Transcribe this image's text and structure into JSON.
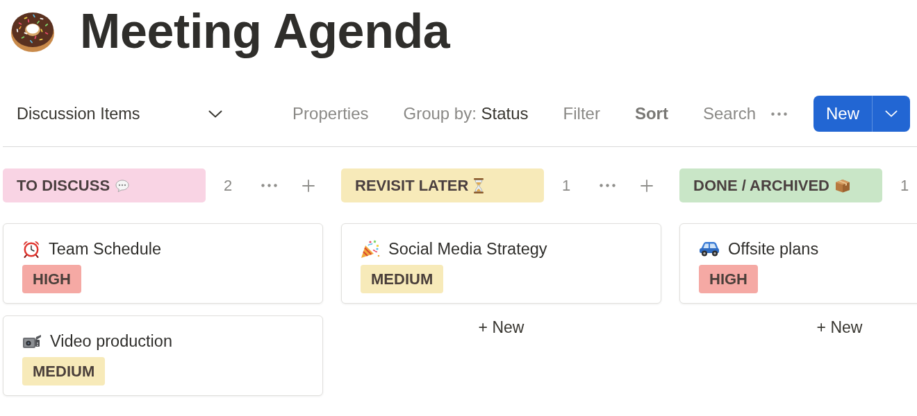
{
  "page": {
    "title": "Meeting Agenda"
  },
  "toolbar": {
    "view": "Discussion Items",
    "actions": [
      {
        "label": "Properties",
        "active": false
      },
      {
        "label": "Group by:",
        "value": "Status",
        "active": false
      },
      {
        "label": "Filter",
        "active": false
      },
      {
        "label": "Sort",
        "active": true
      },
      {
        "label": "Search",
        "active": false
      }
    ],
    "new_button": "New"
  },
  "columns": [
    {
      "title": "TO DISCUSS",
      "color": "#f9d4e4",
      "count": "2",
      "cards": [
        {
          "title": "Team Schedule",
          "tag": {
            "label": "HIGH",
            "color": "#f5a9a4"
          }
        },
        {
          "title": "Video production",
          "tag": {
            "label": "MEDIUM",
            "color": "#f7eab9"
          }
        }
      ]
    },
    {
      "title": "REVISIT LATER",
      "color": "#f7eab9",
      "count": "1",
      "cards": [
        {
          "title": "Social Media Strategy",
          "tag": {
            "label": "MEDIUM",
            "color": "#f7eab9"
          }
        }
      ],
      "add_label": "+ New"
    },
    {
      "title": "DONE / ARCHIVED",
      "color": "#c9e6c7",
      "count": "1",
      "cards": [
        {
          "title": "Offsite plans",
          "tag": {
            "label": "HIGH",
            "color": "#f5a9a4"
          }
        }
      ],
      "add_label": "+ New"
    }
  ]
}
